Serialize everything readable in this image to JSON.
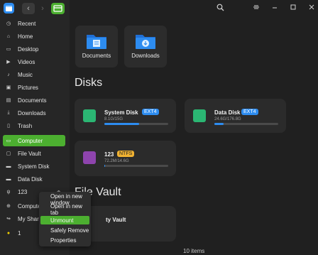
{
  "toolbar": {
    "back": "‹",
    "forward": "›",
    "icons": [
      "search-icon",
      "menu-icon",
      "minimize-icon",
      "maximize-icon",
      "close-icon"
    ]
  },
  "sidebar": {
    "items": [
      {
        "label": "Recent",
        "icon": "clock-icon"
      },
      {
        "label": "Home",
        "icon": "home-icon"
      },
      {
        "label": "Desktop",
        "icon": "desktop-icon"
      },
      {
        "label": "Videos",
        "icon": "video-icon"
      },
      {
        "label": "Music",
        "icon": "music-icon"
      },
      {
        "label": "Pictures",
        "icon": "picture-icon"
      },
      {
        "label": "Documents",
        "icon": "document-icon"
      },
      {
        "label": "Downloads",
        "icon": "download-icon"
      },
      {
        "label": "Trash",
        "icon": "trash-icon"
      },
      {
        "label": "Computer",
        "icon": "computer-icon"
      },
      {
        "label": "File Vault",
        "icon": "vault-icon"
      },
      {
        "label": "System Disk",
        "icon": "disk-icon"
      },
      {
        "label": "Data Disk",
        "icon": "disk-icon"
      },
      {
        "label": "123",
        "icon": "usb-icon"
      },
      {
        "label": "Computer",
        "icon": "network-icon"
      },
      {
        "label": "My Shares",
        "icon": "share-icon"
      },
      {
        "label": "1",
        "icon": "tag-icon"
      }
    ]
  },
  "main": {
    "folders": [
      {
        "label": "Documents"
      },
      {
        "label": "Downloads"
      }
    ],
    "disks_title": "Disks",
    "disks": [
      {
        "name": "System Disk",
        "fs": "EXT4",
        "size": "8.1G/15G",
        "used_fraction": 0.54
      },
      {
        "name": "Data Disk",
        "fs": "EXT4",
        "size": "24.6G/176.8G",
        "used_fraction": 0.14
      },
      {
        "name": "123",
        "fs": "NTFS",
        "size": "72.2M/14.6G",
        "used_fraction": 0.01
      }
    ],
    "vault_title": "File Vault",
    "vault_label": "ty Vault"
  },
  "status": {
    "items": "10 items"
  },
  "context_menu": {
    "items": [
      "Open in new window",
      "Open in new tab",
      "Unmount",
      "Safely Remove",
      "Properties"
    ],
    "highlighted": 2
  },
  "colors": {
    "accent": "#4caf30",
    "blue": "#2d8cf0",
    "ntfs": "#f0b232"
  }
}
